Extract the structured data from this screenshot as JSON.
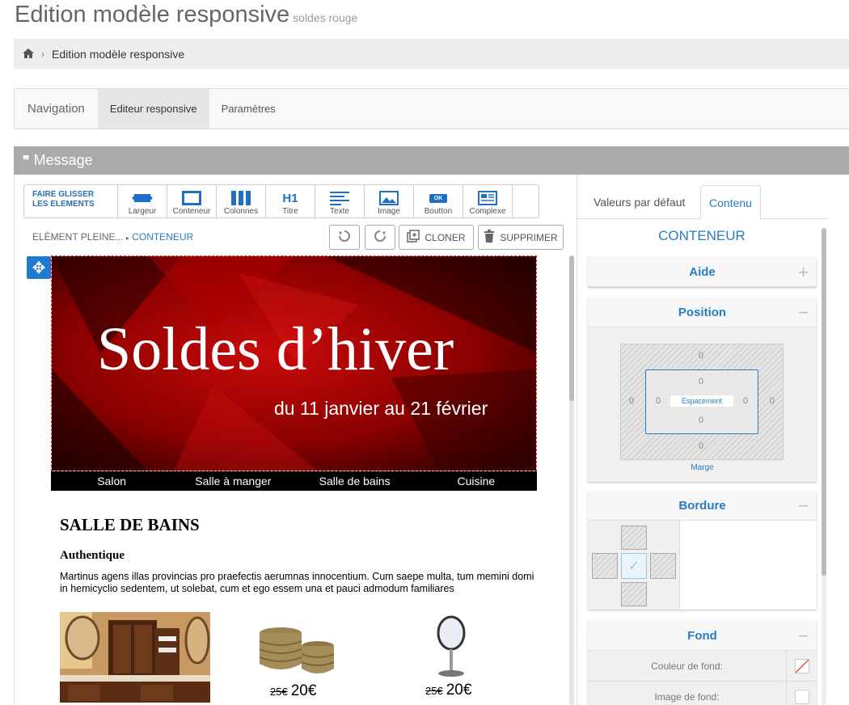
{
  "page": {
    "title": "Edition modèle responsive",
    "subtitle": "soldes rouge"
  },
  "breadcrumb": {
    "current": "Edition modèle responsive"
  },
  "tabs": [
    {
      "label": "Navigation"
    },
    {
      "label": "Editeur responsive"
    },
    {
      "label": "Paramètres"
    }
  ],
  "panel": {
    "title": "Message"
  },
  "toolbar": {
    "drag_line1": "FAIRE GLISSER",
    "drag_line2": "LES ELEMENTS",
    "tools": [
      {
        "label": "Largeur"
      },
      {
        "label": "Conteneur"
      },
      {
        "label": "Colonnes"
      },
      {
        "label": "Titre",
        "glyph": "H1"
      },
      {
        "label": "Texte"
      },
      {
        "label": "Image"
      },
      {
        "label": "Boutton",
        "glyph": "OK"
      },
      {
        "label": "Complexe"
      }
    ]
  },
  "path": {
    "parent": "ELÉMENT PLEINE...",
    "current": "CONTENEUR"
  },
  "actions": {
    "clone": "CLONER",
    "delete": "SUPPRIMER"
  },
  "email": {
    "banner_title": "Soldes d’hiver",
    "banner_subtitle": "du 11 janvier au 21 février",
    "categories": [
      "Salon",
      "Salle à manger",
      "Salle de bains",
      "Cuisine"
    ],
    "section_title": "SALLE DE BAINS",
    "section_subtitle": "Authentique",
    "section_text": "Martinus agens illas provincias pro praefectis aerumnas innocentium. Cum saepe multa, tum memini domi in hemicyclio sedentem, ut solebat, cum et ego essem una et pauci admodum familiares",
    "products": [
      {
        "old": "25€",
        "new": "20€"
      },
      {
        "old": "25€",
        "new": "20€"
      }
    ]
  },
  "sidebar": {
    "tabs": [
      {
        "label": "Valeurs par défaut"
      },
      {
        "label": "Contenu"
      }
    ],
    "title": "CONTENEUR",
    "aide": "Aide",
    "position": {
      "title": "Position",
      "margin_label": "Marge",
      "padding_label": "Espacement",
      "margin": {
        "top": "0",
        "right": "0",
        "bottom": "0",
        "left": "0"
      },
      "padding": {
        "top": "0",
        "right": "0",
        "bottom": "0",
        "left": "0"
      }
    },
    "border": {
      "title": "Bordure"
    },
    "fond": {
      "title": "Fond",
      "color_label": "Couleur de fond:",
      "image_label": "Image de fond:"
    }
  },
  "colors": {
    "accent": "#2a7bc4",
    "panel_header": "#aaaaaa",
    "banner_red": "#b80000"
  }
}
